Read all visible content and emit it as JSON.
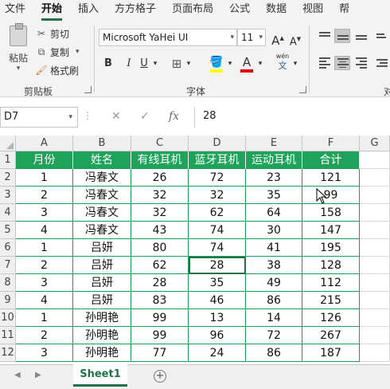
{
  "ribbon_tabs": [
    "文件",
    "开始",
    "插入",
    "方方格子",
    "页面布局",
    "公式",
    "数据",
    "视图",
    "帮"
  ],
  "ribbon": {
    "paste": "粘贴",
    "cut": "剪切",
    "copy": "复制",
    "format_painter": "格式刷",
    "clipboard_group": "剪贴板",
    "font_name": "Microsoft YaHei UI",
    "font_size": "11",
    "font_group": "字体",
    "bold": "B",
    "italic": "I",
    "underline": "U",
    "grow_font": "A",
    "shrink_font": "A",
    "phonetic_top": "wén",
    "phonetic_bottom": "文",
    "alignment_group_partial": "对",
    "colors": {
      "fill": "#ffff00",
      "font": "#e00000",
      "accent": "#217346"
    }
  },
  "formula_bar": {
    "name_box": "D7",
    "fx": "fx",
    "value": "28"
  },
  "grid": {
    "columns": [
      "A",
      "B",
      "C",
      "D",
      "E",
      "F",
      "G"
    ],
    "rows": [
      "1",
      "2",
      "3",
      "4",
      "5",
      "6",
      "7",
      "8",
      "9",
      "10",
      "11",
      "12"
    ],
    "header": [
      "月份",
      "姓名",
      "有线耳机",
      "蓝牙耳机",
      "运动耳机",
      "合计"
    ],
    "data": [
      [
        "1",
        "冯春文",
        "26",
        "72",
        "23",
        "121"
      ],
      [
        "2",
        "冯春文",
        "32",
        "32",
        "35",
        "99"
      ],
      [
        "3",
        "冯春文",
        "32",
        "62",
        "64",
        "158"
      ],
      [
        "4",
        "冯春文",
        "43",
        "74",
        "30",
        "147"
      ],
      [
        "1",
        "吕妍",
        "80",
        "74",
        "41",
        "195"
      ],
      [
        "2",
        "吕妍",
        "62",
        "28",
        "38",
        "128"
      ],
      [
        "3",
        "吕妍",
        "28",
        "35",
        "49",
        "112"
      ],
      [
        "4",
        "吕妍",
        "83",
        "46",
        "86",
        "215"
      ],
      [
        "1",
        "孙明艳",
        "99",
        "13",
        "14",
        "126"
      ],
      [
        "2",
        "孙明艳",
        "99",
        "96",
        "72",
        "267"
      ],
      [
        "3",
        "孙明艳",
        "77",
        "24",
        "86",
        "187"
      ]
    ],
    "header_color": "#1fa35b",
    "selected_cell": "D7"
  },
  "sheets": {
    "active": "Sheet1",
    "add": "+"
  }
}
